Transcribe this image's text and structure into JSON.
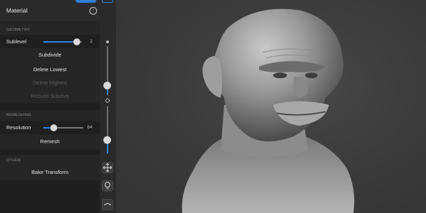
{
  "panel": {
    "material_label": "Material",
    "geometry_section": "GEOMETRY",
    "sublevel_label": "Sublevel",
    "sublevel_value": "2",
    "sublevel_fraction": 0.85,
    "subdivide": "Subdivide",
    "delete_lowest": "Delete Lowest",
    "delete_highest": "Delete Highest",
    "rebuild_subdivs": "Rebuild Subdivs",
    "remeshing_section": "REMESHING",
    "resolution_label": "Resolution",
    "resolution_value": "64",
    "resolution_fraction": 0.3,
    "remesh": "Remesh",
    "other_section": "OTHER",
    "bake_transform": "Bake Transform"
  },
  "toolbar": {
    "top_slider_fraction": 0.9,
    "bottom_slider_fraction": 0.2
  },
  "colors": {
    "accent": "#2f86e0",
    "panel_bg": "#262626",
    "viewport_bg": "#3a3a3a"
  },
  "icons": [
    "chevron-circle-icon",
    "move-icon",
    "lightbulb-icon",
    "stroke-icon"
  ]
}
